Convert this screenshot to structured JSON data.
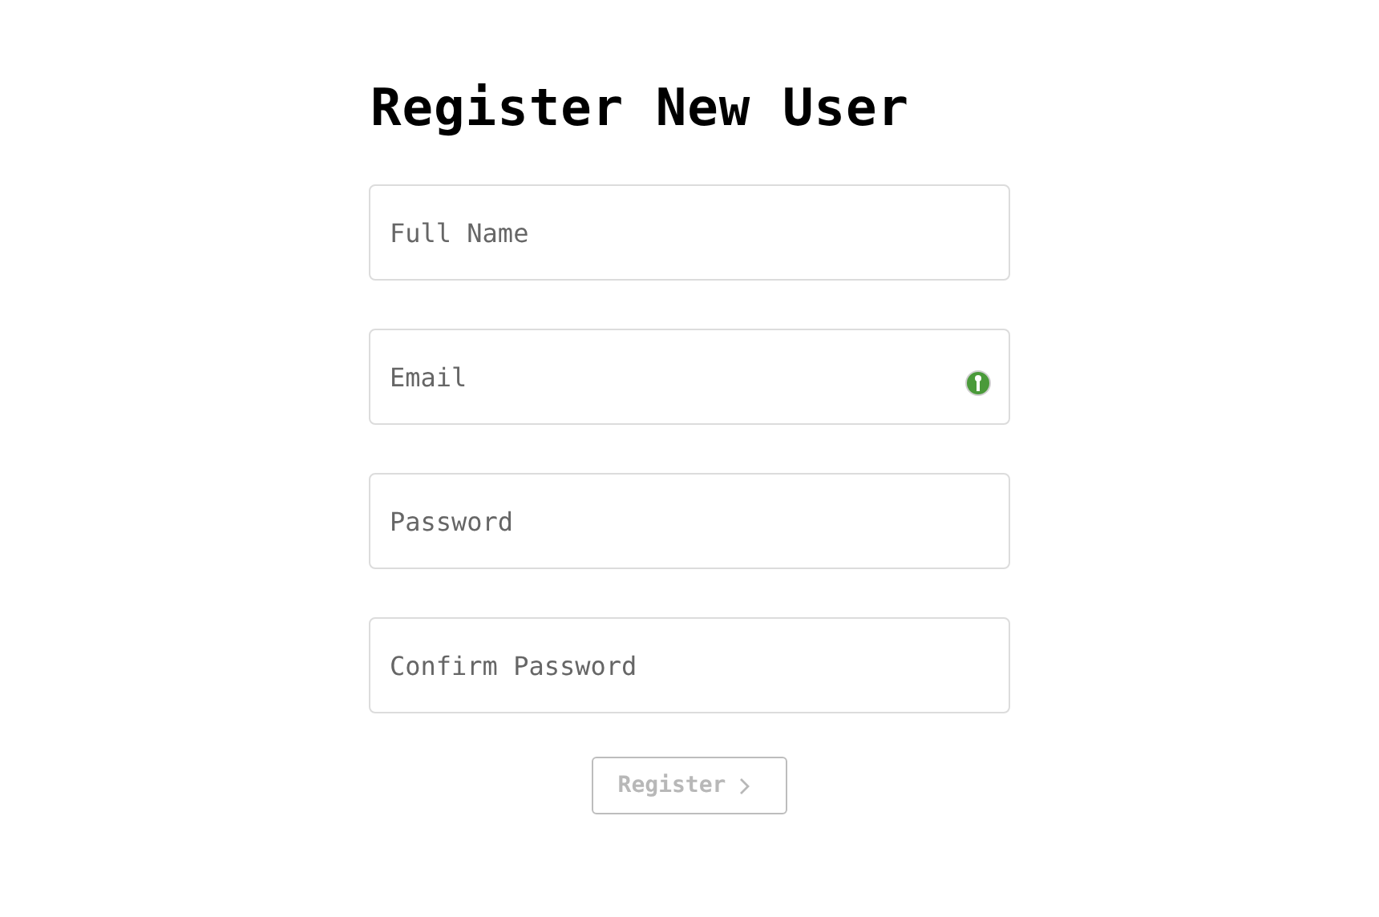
{
  "title": "Register New User",
  "fields": [
    {
      "placeholder": "Full Name",
      "kind": "text"
    },
    {
      "placeholder": "Email",
      "kind": "email"
    },
    {
      "placeholder": "Password",
      "kind": "password"
    },
    {
      "placeholder": "Confirm Password",
      "kind": "password"
    }
  ],
  "button": {
    "label": "Register",
    "disabled": true
  }
}
